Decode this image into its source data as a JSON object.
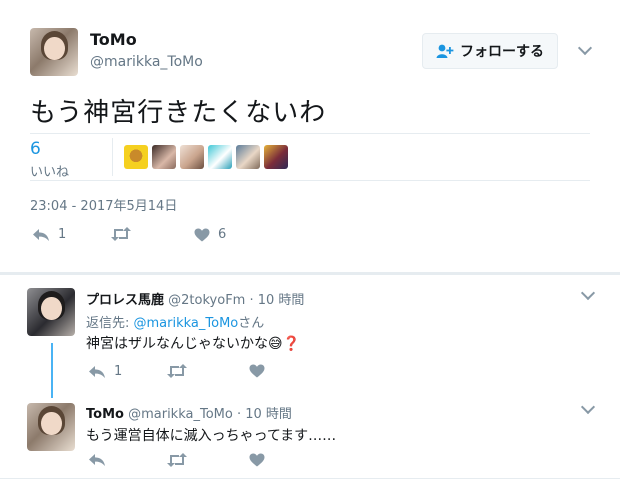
{
  "main_tweet": {
    "display_name": "ToMo",
    "handle": "@marikka_ToMo",
    "follow_label": "フォローする",
    "text": "もう神宮行きたくないわ",
    "likes_count": "6",
    "likes_label": "いいね",
    "timestamp": "23:04 - 2017年5月14日",
    "reply_count": "1",
    "like_count_action": "6"
  },
  "replies": [
    {
      "display_name": "プロレス馬鹿",
      "handle": "@2tokyoFm",
      "time": "· 10 時間",
      "reply_to_prefix": "返信先: ",
      "reply_to_handle": "@marikka_ToMo",
      "reply_to_suffix": "さん",
      "text": "神宮はザルなんじゃないかな😅❓",
      "reply_count": "1"
    },
    {
      "display_name": "ToMo",
      "handle": "@marikka_ToMo",
      "time": "· 10 時間",
      "text": "もう運営自体に滅入っちゃってます……"
    }
  ],
  "colors": {
    "accent": "#1b95e0",
    "thread_line": "#4ab3f4",
    "muted": "#657786",
    "divider": "#e6ecf0"
  }
}
